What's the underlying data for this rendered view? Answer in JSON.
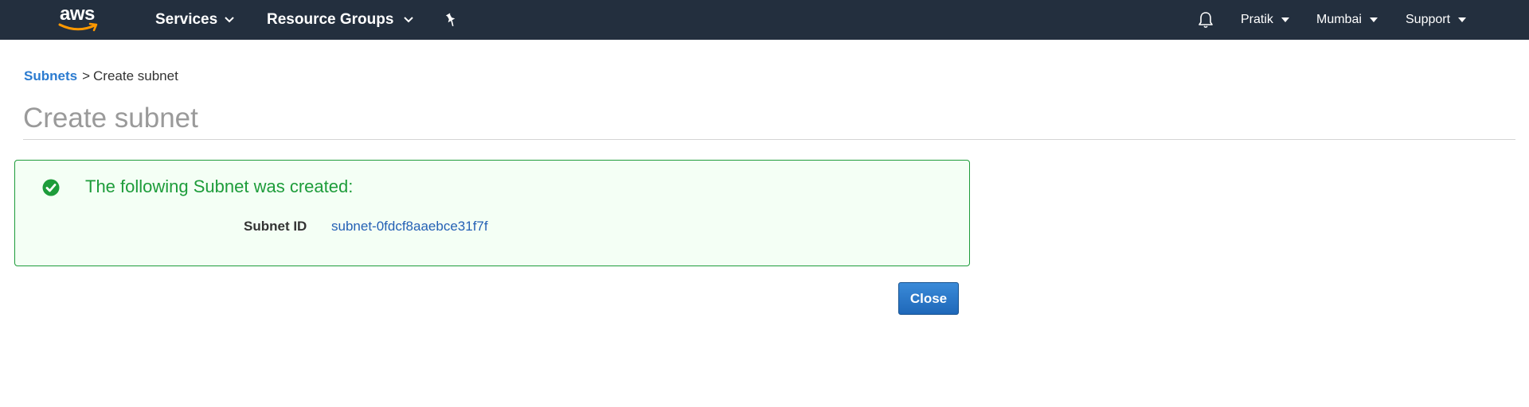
{
  "nav": {
    "logo_text": "aws",
    "services_label": "Services",
    "resource_groups_label": "Resource Groups",
    "user_label": "Pratik",
    "region_label": "Mumbai",
    "support_label": "Support"
  },
  "breadcrumb": {
    "parent_label": "Subnets",
    "separator": ">",
    "current_label": "Create subnet"
  },
  "page": {
    "title": "Create subnet"
  },
  "success": {
    "message": "The following Subnet was created:",
    "subnet_id_label": "Subnet ID",
    "subnet_id_value": "subnet-0fdcf8aaebce31f7f"
  },
  "actions": {
    "close_label": "Close"
  },
  "colors": {
    "nav_bg": "#232f3e",
    "link_blue": "#2b7bd0",
    "success_green": "#1d9c3a",
    "success_bg": "#f4fff5",
    "button_blue": "#2a78c8",
    "logo_smile": "#ff9900"
  },
  "icons": {
    "services_chevron": "chevron-down-icon",
    "pin": "pin-icon",
    "bell": "bell-icon",
    "success": "check-circle-icon"
  }
}
